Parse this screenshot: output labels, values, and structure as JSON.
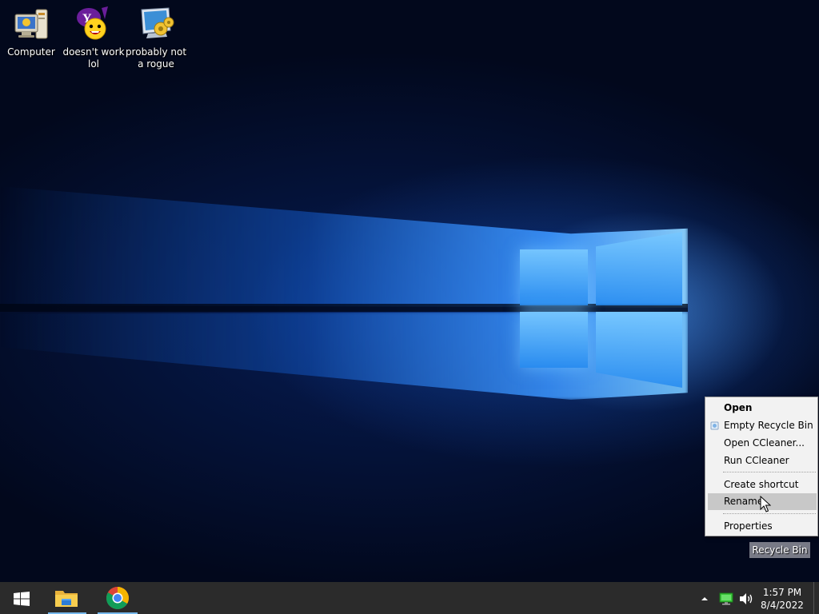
{
  "desktop": {
    "icons": [
      {
        "label": "Computer",
        "icon": "computer-icon"
      },
      {
        "label": "doesn't work lol",
        "icon": "yahoo-messenger-icon"
      },
      {
        "label": "probably not a rogue",
        "icon": "monitor-gears-icon"
      }
    ],
    "recycle_bin": {
      "label": "Recycle Bin",
      "icon": "recycle-bin-icon"
    }
  },
  "context_menu": {
    "items": [
      {
        "label": "Open",
        "bold": true
      },
      {
        "label": "Empty Recycle Bin",
        "icon": "recycle-bin-mini-icon"
      },
      {
        "label": "Open CCleaner..."
      },
      {
        "label": "Run CCleaner"
      },
      {
        "label": "Create shortcut"
      },
      {
        "label": "Rename",
        "highlighted": true
      },
      {
        "label": "Properties"
      }
    ]
  },
  "taskbar": {
    "start": {
      "icon": "windows-logo-icon"
    },
    "pinned": [
      {
        "name": "File Explorer",
        "icon": "folder-icon",
        "running": true
      },
      {
        "name": "Google Chrome",
        "icon": "chrome-icon",
        "running": true
      }
    ],
    "tray": {
      "icons": [
        "show-hidden-icons-arrow",
        "network-icon",
        "volume-icon"
      ],
      "time": "1:57 PM",
      "date": "8/4/2022"
    }
  },
  "colors": {
    "taskbar": "#2b2b2b",
    "menu_bg": "#f2f2f2",
    "menu_highlight": "#c8c8c8",
    "accent": "#76b9ed"
  }
}
